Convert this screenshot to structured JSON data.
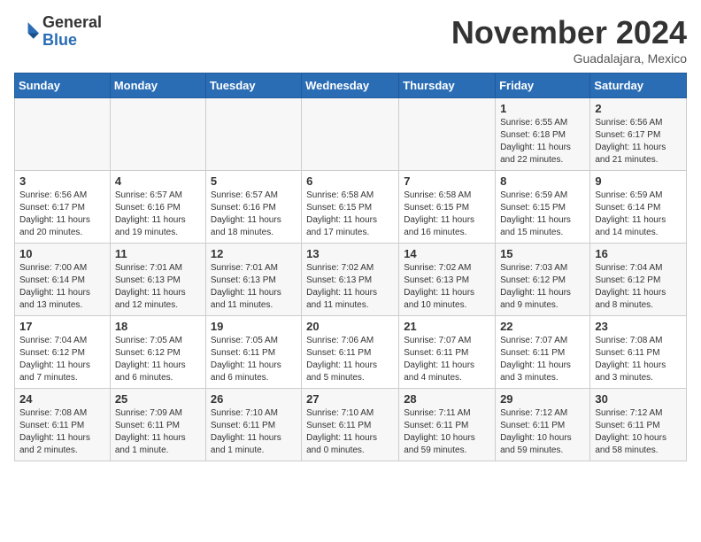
{
  "header": {
    "logo_general": "General",
    "logo_blue": "Blue",
    "month_title": "November 2024",
    "subtitle": "Guadalajara, Mexico"
  },
  "weekdays": [
    "Sunday",
    "Monday",
    "Tuesday",
    "Wednesday",
    "Thursday",
    "Friday",
    "Saturday"
  ],
  "weeks": [
    [
      {
        "day": "",
        "info": ""
      },
      {
        "day": "",
        "info": ""
      },
      {
        "day": "",
        "info": ""
      },
      {
        "day": "",
        "info": ""
      },
      {
        "day": "",
        "info": ""
      },
      {
        "day": "1",
        "info": "Sunrise: 6:55 AM\nSunset: 6:18 PM\nDaylight: 11 hours\nand 22 minutes."
      },
      {
        "day": "2",
        "info": "Sunrise: 6:56 AM\nSunset: 6:17 PM\nDaylight: 11 hours\nand 21 minutes."
      }
    ],
    [
      {
        "day": "3",
        "info": "Sunrise: 6:56 AM\nSunset: 6:17 PM\nDaylight: 11 hours\nand 20 minutes."
      },
      {
        "day": "4",
        "info": "Sunrise: 6:57 AM\nSunset: 6:16 PM\nDaylight: 11 hours\nand 19 minutes."
      },
      {
        "day": "5",
        "info": "Sunrise: 6:57 AM\nSunset: 6:16 PM\nDaylight: 11 hours\nand 18 minutes."
      },
      {
        "day": "6",
        "info": "Sunrise: 6:58 AM\nSunset: 6:15 PM\nDaylight: 11 hours\nand 17 minutes."
      },
      {
        "day": "7",
        "info": "Sunrise: 6:58 AM\nSunset: 6:15 PM\nDaylight: 11 hours\nand 16 minutes."
      },
      {
        "day": "8",
        "info": "Sunrise: 6:59 AM\nSunset: 6:15 PM\nDaylight: 11 hours\nand 15 minutes."
      },
      {
        "day": "9",
        "info": "Sunrise: 6:59 AM\nSunset: 6:14 PM\nDaylight: 11 hours\nand 14 minutes."
      }
    ],
    [
      {
        "day": "10",
        "info": "Sunrise: 7:00 AM\nSunset: 6:14 PM\nDaylight: 11 hours\nand 13 minutes."
      },
      {
        "day": "11",
        "info": "Sunrise: 7:01 AM\nSunset: 6:13 PM\nDaylight: 11 hours\nand 12 minutes."
      },
      {
        "day": "12",
        "info": "Sunrise: 7:01 AM\nSunset: 6:13 PM\nDaylight: 11 hours\nand 11 minutes."
      },
      {
        "day": "13",
        "info": "Sunrise: 7:02 AM\nSunset: 6:13 PM\nDaylight: 11 hours\nand 11 minutes."
      },
      {
        "day": "14",
        "info": "Sunrise: 7:02 AM\nSunset: 6:13 PM\nDaylight: 11 hours\nand 10 minutes."
      },
      {
        "day": "15",
        "info": "Sunrise: 7:03 AM\nSunset: 6:12 PM\nDaylight: 11 hours\nand 9 minutes."
      },
      {
        "day": "16",
        "info": "Sunrise: 7:04 AM\nSunset: 6:12 PM\nDaylight: 11 hours\nand 8 minutes."
      }
    ],
    [
      {
        "day": "17",
        "info": "Sunrise: 7:04 AM\nSunset: 6:12 PM\nDaylight: 11 hours\nand 7 minutes."
      },
      {
        "day": "18",
        "info": "Sunrise: 7:05 AM\nSunset: 6:12 PM\nDaylight: 11 hours\nand 6 minutes."
      },
      {
        "day": "19",
        "info": "Sunrise: 7:05 AM\nSunset: 6:11 PM\nDaylight: 11 hours\nand 6 minutes."
      },
      {
        "day": "20",
        "info": "Sunrise: 7:06 AM\nSunset: 6:11 PM\nDaylight: 11 hours\nand 5 minutes."
      },
      {
        "day": "21",
        "info": "Sunrise: 7:07 AM\nSunset: 6:11 PM\nDaylight: 11 hours\nand 4 minutes."
      },
      {
        "day": "22",
        "info": "Sunrise: 7:07 AM\nSunset: 6:11 PM\nDaylight: 11 hours\nand 3 minutes."
      },
      {
        "day": "23",
        "info": "Sunrise: 7:08 AM\nSunset: 6:11 PM\nDaylight: 11 hours\nand 3 minutes."
      }
    ],
    [
      {
        "day": "24",
        "info": "Sunrise: 7:08 AM\nSunset: 6:11 PM\nDaylight: 11 hours\nand 2 minutes."
      },
      {
        "day": "25",
        "info": "Sunrise: 7:09 AM\nSunset: 6:11 PM\nDaylight: 11 hours\nand 1 minute."
      },
      {
        "day": "26",
        "info": "Sunrise: 7:10 AM\nSunset: 6:11 PM\nDaylight: 11 hours\nand 1 minute."
      },
      {
        "day": "27",
        "info": "Sunrise: 7:10 AM\nSunset: 6:11 PM\nDaylight: 11 hours\nand 0 minutes."
      },
      {
        "day": "28",
        "info": "Sunrise: 7:11 AM\nSunset: 6:11 PM\nDaylight: 10 hours\nand 59 minutes."
      },
      {
        "day": "29",
        "info": "Sunrise: 7:12 AM\nSunset: 6:11 PM\nDaylight: 10 hours\nand 59 minutes."
      },
      {
        "day": "30",
        "info": "Sunrise: 7:12 AM\nSunset: 6:11 PM\nDaylight: 10 hours\nand 58 minutes."
      }
    ]
  ]
}
